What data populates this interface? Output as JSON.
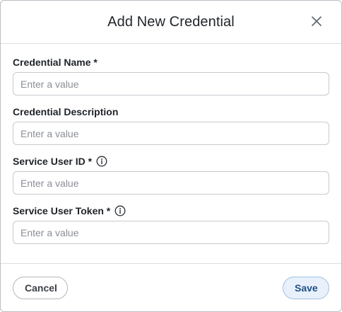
{
  "dialog": {
    "title": "Add New Credential",
    "close_icon": "close-icon"
  },
  "fields": [
    {
      "label": "Credential Name *",
      "placeholder": "Enter a value",
      "value": "",
      "has_info": false
    },
    {
      "label": "Credential Description",
      "placeholder": "Enter a value",
      "value": "",
      "has_info": false
    },
    {
      "label": "Service User ID *",
      "placeholder": "Enter a value",
      "value": "",
      "has_info": true,
      "info_icon": "info-icon"
    },
    {
      "label": "Service User Token *",
      "placeholder": "Enter a value",
      "value": "",
      "has_info": true,
      "info_icon": "info-icon"
    }
  ],
  "footer": {
    "cancel_label": "Cancel",
    "save_label": "Save"
  },
  "colors": {
    "border": "#b9bdc3",
    "save_bg": "#e8f1fb",
    "save_border": "#9fc0e6",
    "save_text": "#1e4f86"
  }
}
